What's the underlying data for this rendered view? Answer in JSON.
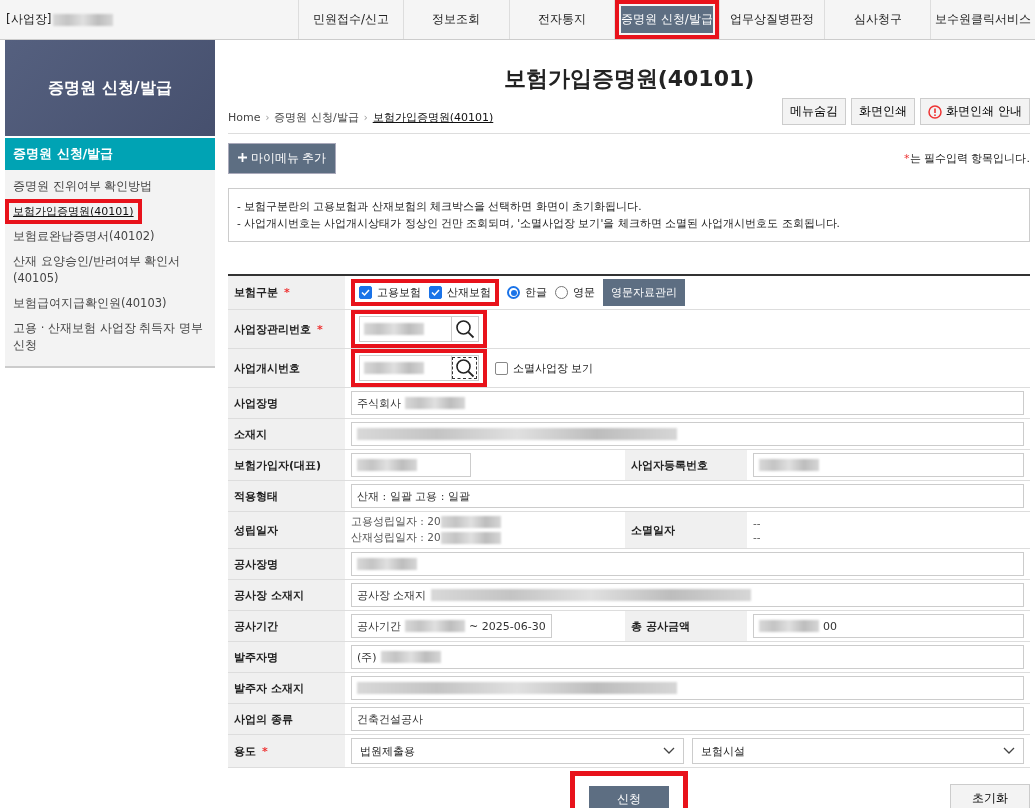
{
  "header": {
    "site": "[사업장]",
    "nav": [
      {
        "label": "민원접수/신고",
        "selected": false,
        "highlighted": false
      },
      {
        "label": "정보조회",
        "selected": false,
        "highlighted": false
      },
      {
        "label": "전자통지",
        "selected": false,
        "highlighted": false
      },
      {
        "label": "증명원 신청/발급",
        "selected": true,
        "highlighted": true
      },
      {
        "label": "업무상질병판정",
        "selected": false,
        "highlighted": false
      },
      {
        "label": "심사청구",
        "selected": false,
        "highlighted": false
      },
      {
        "label": "보수원클릭서비스",
        "selected": false,
        "highlighted": false
      }
    ]
  },
  "sidebar": {
    "banner": "증명원 신청/발급",
    "title": "증명원 신청/발급",
    "items": [
      {
        "label": "증명원 진위여부 확인방법",
        "selected": false,
        "highlighted": false
      },
      {
        "label": "보험가입증명원(40101)",
        "selected": true,
        "highlighted": true
      },
      {
        "label": "보험료완납증명서(40102)",
        "selected": false,
        "highlighted": false
      },
      {
        "label": "산재 요양승인/반려여부 확인서(40105)",
        "selected": false,
        "highlighted": false
      },
      {
        "label": "보험급여지급확인원(40103)",
        "selected": false,
        "highlighted": false
      },
      {
        "label": "고용 · 산재보험 사업장 취득자 명부 신청",
        "selected": false,
        "highlighted": false
      }
    ]
  },
  "page": {
    "title": "보험가입증명원(40101)",
    "breadcrumb": [
      {
        "label": "Home",
        "current": false
      },
      {
        "label": "증명원 신청/발급",
        "separator": "›",
        "current": false
      },
      {
        "label": "보험가입증명원(40101)",
        "separator": "›",
        "current": true
      }
    ],
    "tools": [
      {
        "label": "메뉴숨김",
        "alert": false
      },
      {
        "label": "화면인쇄",
        "alert": false
      },
      {
        "label": "화면인쇄 안내",
        "alert": true
      }
    ],
    "add_button": "마이메뉴 추가",
    "required_mark": "*",
    "required_note": "는 필수입력 항목입니다.",
    "notices": [
      "- 보험구분란의 고용보험과 산재보험의 체크박스을 선택하면 화면이 초기화됩니다.",
      "- 사업개시번호는 사업개시상태가 정상인 건만 조회되며, '소멸사업장 보기'을 체크하면 소멸된 사업개시번호도 조회됩니다."
    ]
  },
  "form": {
    "rows": [
      {
        "kind": "insurance",
        "label": "보험구분",
        "mark": "*",
        "highlighted": true,
        "checkboxes": [
          {
            "label": "고용보험",
            "checked": true
          },
          {
            "label": "산재보험",
            "checked": true
          }
        ],
        "radios": [
          {
            "label": "한글",
            "selected": true
          },
          {
            "label": "영문",
            "selected": false
          }
        ],
        "button": "영문자료관리"
      },
      {
        "kind": "search",
        "label": "사업장관리번호",
        "mark": "*",
        "highlighted": true,
        "focused": false
      },
      {
        "kind": "search",
        "label": "사업개시번호",
        "highlighted": true,
        "focused": true,
        "option": {
          "label": "소멸사업장 보기",
          "checked": false
        }
      },
      {
        "kind": "text",
        "label": "사업장명",
        "parts": [
          {
            "kind": "text",
            "text": "주식회사"
          },
          {
            "kind": "blur"
          }
        ]
      },
      {
        "kind": "text",
        "label": "소재지",
        "parts": [
          {
            "kind": "blurline"
          }
        ]
      },
      {
        "kind": "pair",
        "label": "보험가입자(대표)",
        "parts": [
          {
            "kind": "blur"
          }
        ],
        "second": {
          "label": "사업자등록번호",
          "parts": [
            {
              "kind": "blur"
            }
          ]
        }
      },
      {
        "kind": "text",
        "label": "적용형태",
        "parts": [
          {
            "kind": "text",
            "text": "산재 : 일괄 고용 : 일괄"
          }
        ]
      },
      {
        "kind": "dates",
        "label": "성립일자",
        "lines": [
          "고용성립일자 : 20",
          "산재성립일자 : 20"
        ],
        "second": {
          "label": "소멸일자",
          "lines": [
            "--",
            "--"
          ]
        }
      },
      {
        "kind": "text",
        "label": "공사장명",
        "parts": [
          {
            "kind": "blur"
          }
        ]
      },
      {
        "kind": "text",
        "label": "공사장 소재지",
        "parts": [
          {
            "kind": "text",
            "text": "공사장 소재지"
          },
          {
            "kind": "blurline"
          }
        ]
      },
      {
        "kind": "pair",
        "label": "공사기간",
        "parts": [
          {
            "kind": "text",
            "text": "공사기간"
          },
          {
            "kind": "blur"
          },
          {
            "kind": "text",
            "text": "~ 2025-06-30"
          }
        ],
        "second": {
          "label": "총 공사금액",
          "parts": [
            {
              "kind": "blur"
            },
            {
              "kind": "text",
              "text": "00"
            }
          ]
        }
      },
      {
        "kind": "text",
        "label": "발주자명",
        "parts": [
          {
            "kind": "text",
            "text": "(주)"
          },
          {
            "kind": "blur"
          }
        ]
      },
      {
        "kind": "text",
        "label": "발주자 소재지",
        "parts": [
          {
            "kind": "blurline"
          }
        ]
      },
      {
        "kind": "text",
        "label": "사업의 종류",
        "parts": [
          {
            "kind": "text",
            "text": "건축건설공사"
          }
        ]
      },
      {
        "kind": "select",
        "label": "용도",
        "mark": "*",
        "selects": [
          "법원제출용",
          "보험시설"
        ]
      }
    ],
    "submit": {
      "label": "신청",
      "highlighted": true
    },
    "reset": "초기화"
  }
}
